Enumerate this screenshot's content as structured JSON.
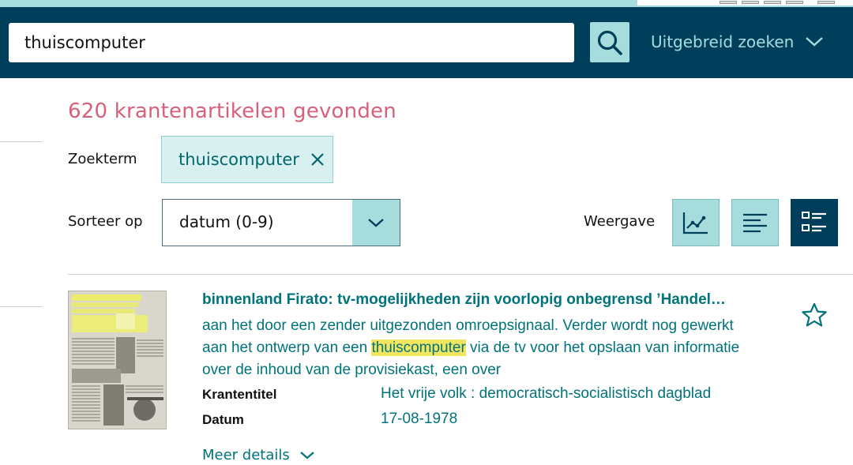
{
  "search": {
    "query": "thuiscomputer",
    "advanced_label": "Uitgebreid zoeken"
  },
  "results": {
    "count_text": "620 krantenartikelen gevonden",
    "searchterm_label": "Zoekterm",
    "searchterm_chip": "thuiscomputer",
    "sort_label": "Sorteer op",
    "sort_value": "datum (0-9)",
    "view_label": "Weergave"
  },
  "items": [
    {
      "title": "binnenland Firato: tv-mogelijkheden zijn voorlopig onbegrensd ’Handel…",
      "snippet_line1": "aan het door een zender uitgezonden omroepsignaal. Verder wordt nog gewerkt",
      "snippet_line2_before": "aan het ontwerp van een ",
      "snippet_highlight": "thuiscomputer",
      "snippet_line2_after": " via de tv voor het opslaan van informatie",
      "snippet_line3": "over de inhoud van de provisiekast, een over",
      "newspaper_label": "Krantentitel",
      "newspaper_value": "Het vrije volk : democratisch-socialistisch dagblad",
      "date_label": "Datum",
      "date_value": "17-08-1978",
      "more_label": "Meer details"
    }
  ],
  "colors": {
    "navy": "#003f5c",
    "teal_light": "#a6dcdc",
    "teal_text": "#00737b",
    "count_pink": "#d9607a",
    "highlight": "#f2e660"
  },
  "icons": [
    "search-icon",
    "chevron-down-icon",
    "close-icon",
    "graph-view-icon",
    "list-view-icon",
    "detail-view-icon",
    "star-icon"
  ]
}
